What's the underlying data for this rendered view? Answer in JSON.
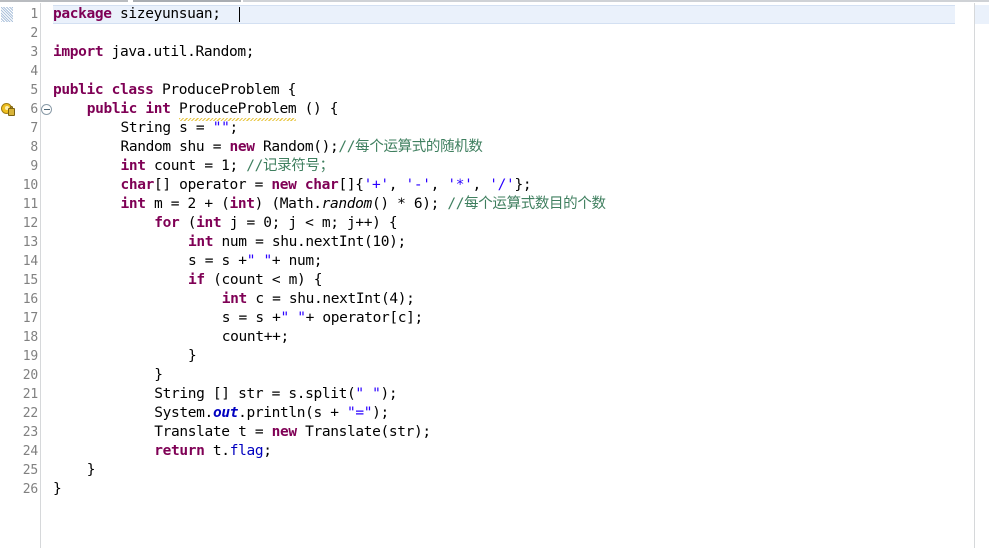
{
  "editor": {
    "kind": "java-source-editor",
    "language": "Java",
    "font_size_px": 14.5,
    "line_height_px": 19,
    "first_visible_line": 1,
    "total_visible_lines": 26,
    "current_line": 1,
    "caret_line": 1,
    "caret_column": 23,
    "colors": {
      "background": "#ffffff",
      "current_line_highlight": "#eaf1fb",
      "line_number": "#808080",
      "keyword": "#7f0055",
      "string": "#2a00ff",
      "comment": "#3f7f5f",
      "field": "#0000c0",
      "static_field": "#0000c0",
      "default_text": "#000000",
      "warning_squiggle": "#e8c84a",
      "gutter_separator": "#d6d8da"
    },
    "gutter": {
      "annotations": [
        {
          "line": 6,
          "icon": "warning-lock-icon",
          "tooltip": ""
        }
      ],
      "folding_markers": [
        {
          "line": 6,
          "icon": "collapse-minus-icon",
          "state": "expanded"
        }
      ]
    },
    "lines": [
      {
        "number": 1,
        "indent": 0,
        "highlighted": true,
        "tokens": [
          {
            "t": "package",
            "c": "kw"
          },
          {
            "t": " sizeyunsuan;",
            "c": "plain"
          }
        ]
      },
      {
        "number": 2,
        "indent": 0,
        "tokens": []
      },
      {
        "number": 3,
        "indent": 0,
        "tokens": [
          {
            "t": "import",
            "c": "kw"
          },
          {
            "t": " java.util.Random;",
            "c": "plain"
          }
        ]
      },
      {
        "number": 4,
        "indent": 0,
        "tokens": []
      },
      {
        "number": 5,
        "indent": 0,
        "tokens": [
          {
            "t": "public class",
            "c": "kw"
          },
          {
            "t": " ProduceProblem {",
            "c": "plain"
          }
        ]
      },
      {
        "number": 6,
        "indent": 1,
        "tokens": [
          {
            "t": "public int",
            "c": "kw"
          },
          {
            "t": " ",
            "c": "plain"
          },
          {
            "t": "ProduceProblem",
            "c": "plain",
            "squiggle": true
          },
          {
            "t": " () {",
            "c": "plain"
          }
        ]
      },
      {
        "number": 7,
        "indent": 2,
        "tokens": [
          {
            "t": "String s = ",
            "c": "plain"
          },
          {
            "t": "\"\"",
            "c": "str"
          },
          {
            "t": ";",
            "c": "plain"
          }
        ]
      },
      {
        "number": 8,
        "indent": 2,
        "tokens": [
          {
            "t": "Random shu = ",
            "c": "plain"
          },
          {
            "t": "new",
            "c": "kw"
          },
          {
            "t": " Random();",
            "c": "plain"
          },
          {
            "t": "//每个运算式的随机数",
            "c": "cmt"
          }
        ]
      },
      {
        "number": 9,
        "indent": 2,
        "tokens": [
          {
            "t": "int",
            "c": "kw"
          },
          {
            "t": " count = 1; ",
            "c": "plain"
          },
          {
            "t": "//记录符号；",
            "c": "cmt"
          }
        ]
      },
      {
        "number": 10,
        "indent": 2,
        "tokens": [
          {
            "t": "char",
            "c": "kw"
          },
          {
            "t": "[] operator = ",
            "c": "plain"
          },
          {
            "t": "new",
            "c": "kw"
          },
          {
            "t": " ",
            "c": "plain"
          },
          {
            "t": "char",
            "c": "kw"
          },
          {
            "t": "[]{",
            "c": "plain"
          },
          {
            "t": "'+'",
            "c": "str"
          },
          {
            "t": ", ",
            "c": "plain"
          },
          {
            "t": "'-'",
            "c": "str"
          },
          {
            "t": ", ",
            "c": "plain"
          },
          {
            "t": "'*'",
            "c": "str"
          },
          {
            "t": ", ",
            "c": "plain"
          },
          {
            "t": "'/'",
            "c": "str"
          },
          {
            "t": "};",
            "c": "plain"
          }
        ]
      },
      {
        "number": 11,
        "indent": 2,
        "tokens": [
          {
            "t": "int",
            "c": "kw"
          },
          {
            "t": " m = 2 + (",
            "c": "plain"
          },
          {
            "t": "int",
            "c": "kw"
          },
          {
            "t": ") (Math.",
            "c": "plain"
          },
          {
            "t": "random",
            "c": "smeth"
          },
          {
            "t": "() * 6); ",
            "c": "plain"
          },
          {
            "t": "//每个运算式数目的个数",
            "c": "cmt"
          }
        ]
      },
      {
        "number": 12,
        "indent": 3,
        "tokens": [
          {
            "t": "for",
            "c": "kw"
          },
          {
            "t": " (",
            "c": "plain"
          },
          {
            "t": "int",
            "c": "kw"
          },
          {
            "t": " j = 0; j < m; j++) {",
            "c": "plain"
          }
        ]
      },
      {
        "number": 13,
        "indent": 4,
        "tokens": [
          {
            "t": "int",
            "c": "kw"
          },
          {
            "t": " num = shu.nextInt(10);",
            "c": "plain"
          }
        ]
      },
      {
        "number": 14,
        "indent": 4,
        "tokens": [
          {
            "t": "s = s +",
            "c": "plain"
          },
          {
            "t": "\" \"",
            "c": "str"
          },
          {
            "t": "+ num;",
            "c": "plain"
          }
        ]
      },
      {
        "number": 15,
        "indent": 4,
        "tokens": [
          {
            "t": "if",
            "c": "kw"
          },
          {
            "t": " (count < m) {",
            "c": "plain"
          }
        ]
      },
      {
        "number": 16,
        "indent": 5,
        "tokens": [
          {
            "t": "int",
            "c": "kw"
          },
          {
            "t": " c = shu.nextInt(4);",
            "c": "plain"
          }
        ]
      },
      {
        "number": 17,
        "indent": 5,
        "tokens": [
          {
            "t": "s = s +",
            "c": "plain"
          },
          {
            "t": "\" \"",
            "c": "str"
          },
          {
            "t": "+ operator[c];",
            "c": "plain"
          }
        ]
      },
      {
        "number": 18,
        "indent": 5,
        "tokens": [
          {
            "t": "count++;",
            "c": "plain"
          }
        ]
      },
      {
        "number": 19,
        "indent": 4,
        "tokens": [
          {
            "t": "}",
            "c": "plain"
          }
        ]
      },
      {
        "number": 20,
        "indent": 3,
        "tokens": [
          {
            "t": "}",
            "c": "plain"
          }
        ]
      },
      {
        "number": 21,
        "indent": 3,
        "tokens": [
          {
            "t": "String [] str = s.split(",
            "c": "plain"
          },
          {
            "t": "\" \"",
            "c": "str"
          },
          {
            "t": ");",
            "c": "plain"
          }
        ]
      },
      {
        "number": 22,
        "indent": 3,
        "tokens": [
          {
            "t": "System.",
            "c": "plain"
          },
          {
            "t": "out",
            "c": "sfld"
          },
          {
            "t": ".println(s + ",
            "c": "plain"
          },
          {
            "t": "\"=\"",
            "c": "str"
          },
          {
            "t": ");",
            "c": "plain"
          }
        ]
      },
      {
        "number": 23,
        "indent": 3,
        "tokens": [
          {
            "t": "Translate t = ",
            "c": "plain"
          },
          {
            "t": "new",
            "c": "kw"
          },
          {
            "t": " Translate(str);",
            "c": "plain"
          }
        ]
      },
      {
        "number": 24,
        "indent": 3,
        "tokens": [
          {
            "t": "return",
            "c": "kw"
          },
          {
            "t": " t.",
            "c": "plain"
          },
          {
            "t": "flag",
            "c": "fld"
          },
          {
            "t": ";",
            "c": "plain"
          }
        ]
      },
      {
        "number": 25,
        "indent": 1,
        "tokens": [
          {
            "t": "}",
            "c": "plain"
          }
        ]
      },
      {
        "number": 26,
        "indent": 0,
        "tokens": [
          {
            "t": "}",
            "c": "plain"
          }
        ]
      }
    ]
  }
}
